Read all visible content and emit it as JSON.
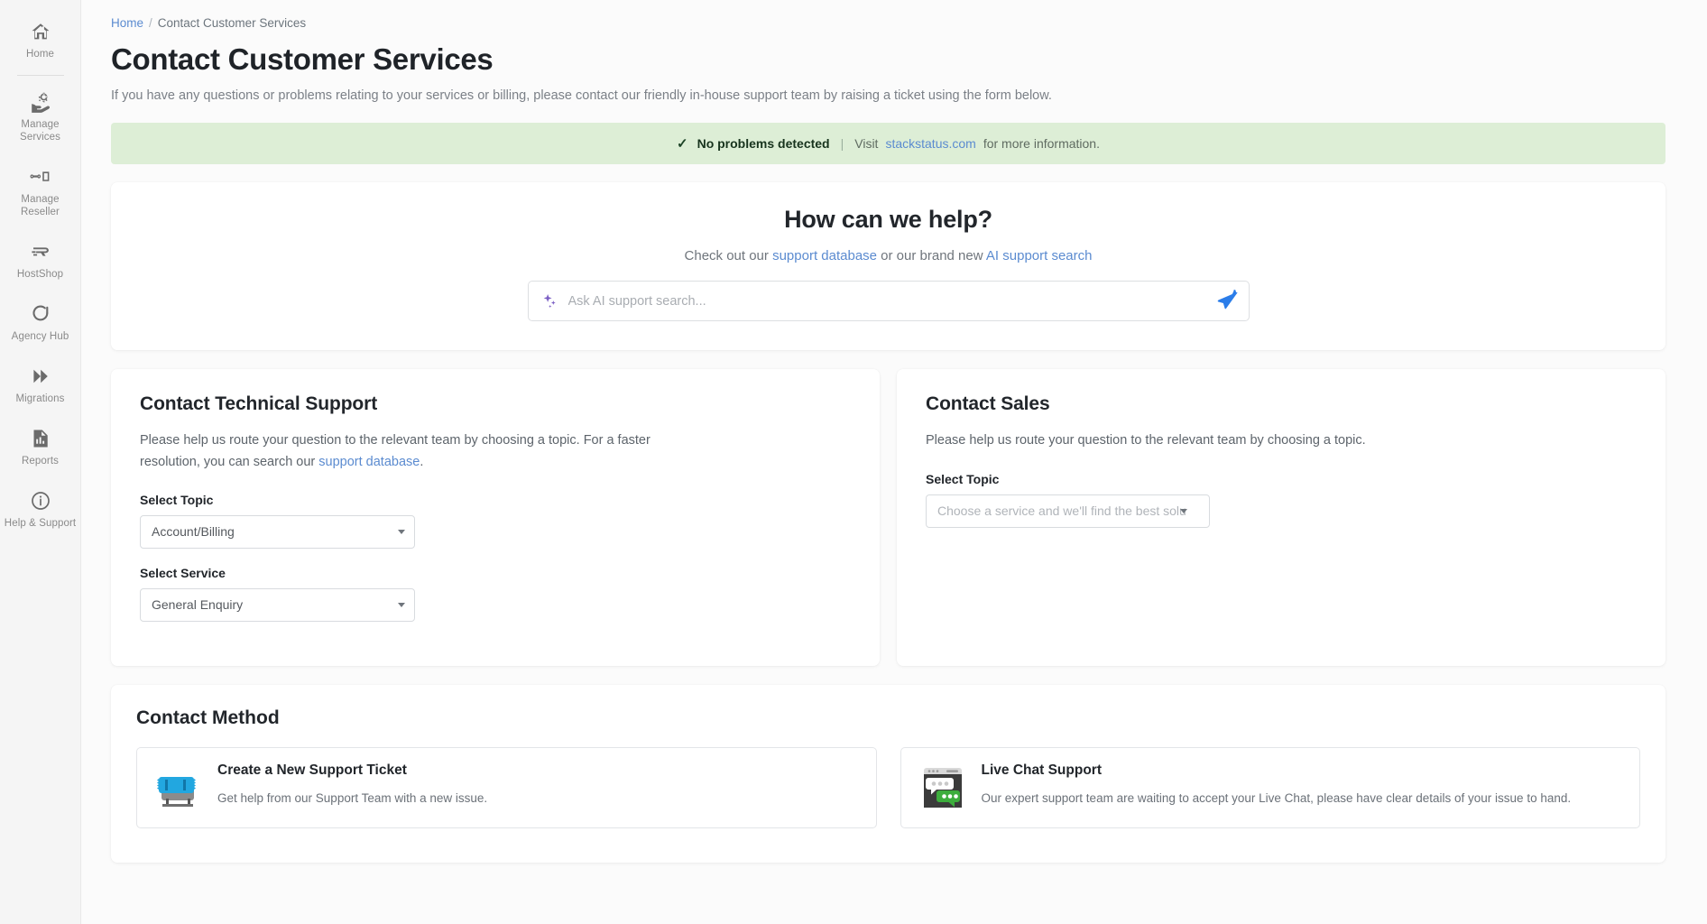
{
  "sidebar": {
    "items": [
      {
        "label": "Home",
        "icon": "home-icon",
        "name": "sidebar-item-home"
      },
      {
        "label": "Manage Services",
        "icon": "manage-services-icon",
        "name": "sidebar-item-manage-services"
      },
      {
        "label": "Manage Reseller",
        "icon": "manage-reseller-icon",
        "name": "sidebar-item-manage-reseller"
      },
      {
        "label": "HostShop",
        "icon": "hostshop-icon",
        "name": "sidebar-item-hostshop"
      },
      {
        "label": "Agency Hub",
        "icon": "agency-hub-icon",
        "name": "sidebar-item-agency-hub"
      },
      {
        "label": "Migrations",
        "icon": "migrations-icon",
        "name": "sidebar-item-migrations"
      },
      {
        "label": "Reports",
        "icon": "reports-icon",
        "name": "sidebar-item-reports"
      },
      {
        "label": "Help & Support",
        "icon": "info-circle-icon",
        "name": "sidebar-item-help-support"
      }
    ]
  },
  "breadcrumb": {
    "home": "Home",
    "separator": "/",
    "current": "Contact Customer Services"
  },
  "page": {
    "title": "Contact Customer Services",
    "subtitle": "If you have any questions or problems relating to your services or billing, please contact our friendly in-house support team by raising a ticket using the form below."
  },
  "status_banner": {
    "check_icon": "check-icon",
    "message": "No problems detected",
    "pipe": "|",
    "visit_prefix": "Visit",
    "link_text": "stackstatus.com",
    "visit_suffix": "for more information.",
    "background_color": "#ddeed6",
    "text_color": "#17331d"
  },
  "help": {
    "heading": "How can we help?",
    "sub_prefix": "Check out our",
    "link_support_database": "support database",
    "sub_middle": "or our brand new",
    "link_ai_search": "AI support search",
    "search_placeholder": "Ask AI support search...",
    "search_value": "",
    "sparkle_icon": "sparkle-icon",
    "send_icon": "send-icon",
    "send_color": "#2b7de9",
    "sparkle_color": "#7b5fc4"
  },
  "technical_support": {
    "heading": "Contact Technical Support",
    "lead_prefix": "Please help us route your question to the relevant team by choosing a topic. For a faster resolution, you can search our",
    "lead_link": "support database",
    "lead_suffix": ".",
    "topic_label": "Select Topic",
    "topic_value": "Account/Billing",
    "service_label": "Select Service",
    "service_value": "General Enquiry"
  },
  "sales": {
    "heading": "Contact Sales",
    "lead": "Please help us route your question to the relevant team by choosing a topic.",
    "topic_label": "Select Topic",
    "topic_placeholder": "Choose a service and we'll find the best soluti..."
  },
  "contact_method": {
    "heading": "Contact Method",
    "options": [
      {
        "title": "Create a New Support Ticket",
        "desc": "Get help from our Support Team with a new issue.",
        "icon": "ticket-icon",
        "name": "method-create-ticket"
      },
      {
        "title": "Live Chat Support",
        "desc": "Our expert support team are waiting to accept your Live Chat, please have clear details of your issue to hand.",
        "icon": "live-chat-icon",
        "name": "method-live-chat"
      }
    ]
  }
}
